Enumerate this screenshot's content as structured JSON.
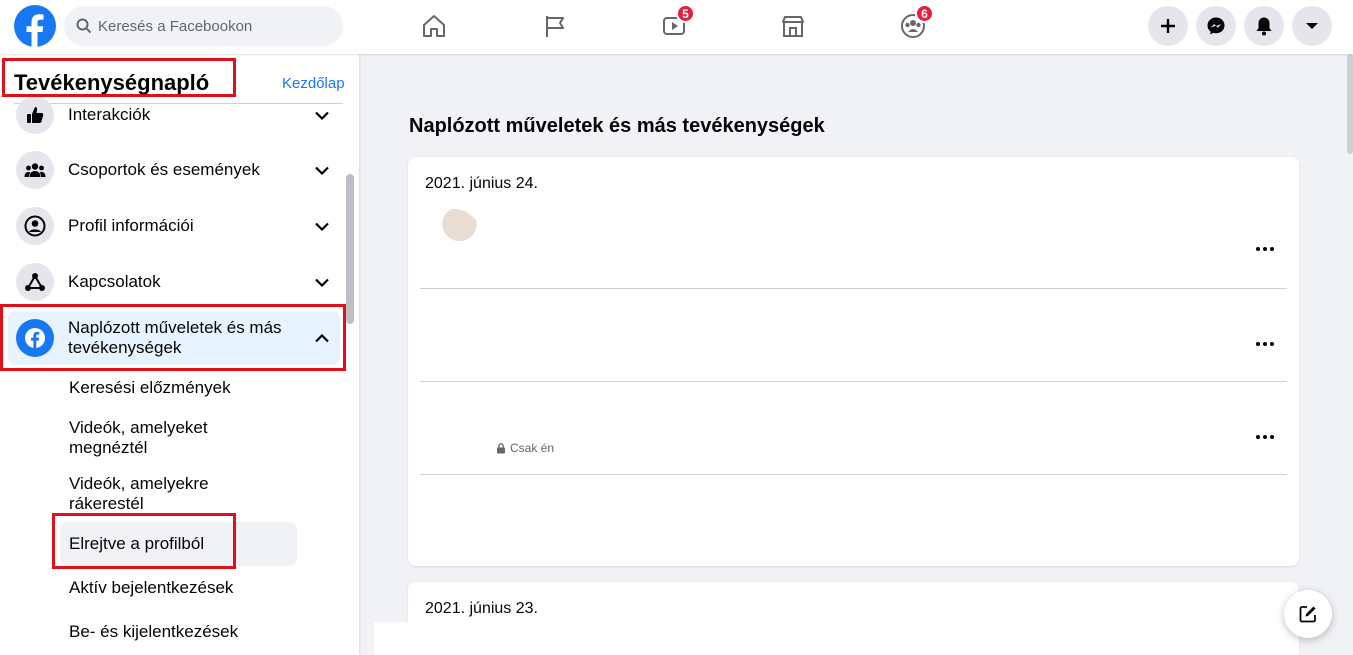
{
  "header": {
    "search_placeholder": "Keresés a Facebookon",
    "nav_icons": [
      "home-icon",
      "flag-icon",
      "watch-icon",
      "marketplace-icon",
      "groups-icon"
    ],
    "watch_badge": "5",
    "groups_badge": "6",
    "right_buttons": [
      "plus-icon",
      "messenger-icon",
      "bell-icon",
      "caret-down-icon"
    ]
  },
  "sidebar": {
    "title": "Tevékenységnapló",
    "home_link": "Kezdőlap",
    "categories": [
      {
        "label": "Interakciók",
        "icon": "thumbs-up-icon"
      },
      {
        "label": "Csoportok és események",
        "icon": "people-icon"
      },
      {
        "label": "Profil információi",
        "icon": "user-circle-icon"
      },
      {
        "label": "Kapcsolatok",
        "icon": "connections-icon"
      },
      {
        "label": "Naplózott műveletek és más tevékenységek",
        "icon": "facebook-icon"
      }
    ],
    "subitems": [
      "Keresési előzmények",
      "Videók, amelyeket megnéztél",
      "Videók, amelyekre rákerestél",
      "Elrejtve a profilból",
      "Aktív bejelentkezések",
      "Be- és kijelentkezések"
    ]
  },
  "main": {
    "title": "Naplózott műveletek és más tevékenységek",
    "cards": [
      {
        "date": "2021. június 24.",
        "privacy": "Csak én"
      },
      {
        "date": "2021. június 23."
      }
    ]
  },
  "colors": {
    "brand": "#1877f2",
    "highlight": "#e0101a",
    "badge": "#e41e3f"
  }
}
